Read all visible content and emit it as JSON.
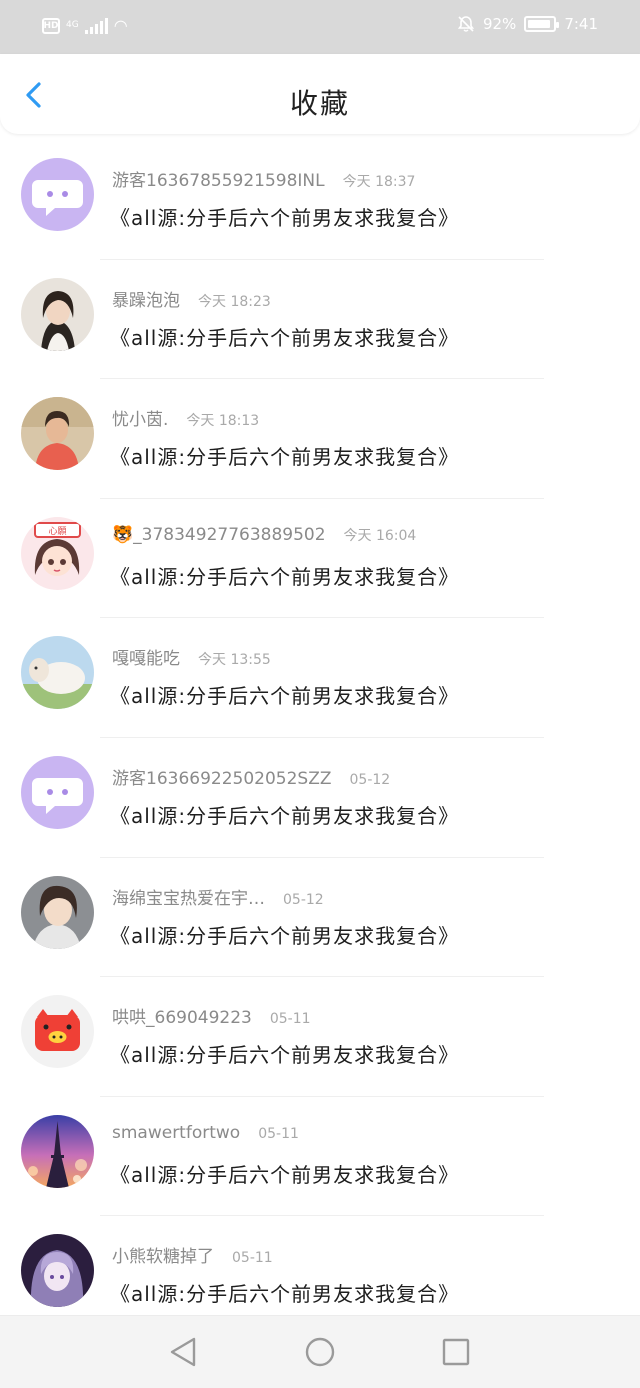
{
  "status_bar": {
    "hd": "HD",
    "network": "4G",
    "battery": "92%",
    "battery_level": 0.92,
    "time": "7:41",
    "icons": [
      "hd-icon",
      "signal-icon",
      "wifi-icon",
      "mute-icon",
      "battery-icon"
    ]
  },
  "header": {
    "title": "收藏",
    "back_icon": "chevron-left-icon",
    "accent": "#2f9bf3"
  },
  "items": [
    {
      "username": "游客16367855921598INL",
      "time": "今天 18:37",
      "message": "《all源:分手后六个前男友求我复合》",
      "avatar": "default-purple-chat"
    },
    {
      "username": "暴躁泡泡",
      "time": "今天 18:23",
      "message": "《all源:分手后六个前男友求我复合》",
      "avatar": "girl-portrait"
    },
    {
      "username": "忧小茵.",
      "time": "今天 18:13",
      "message": "《all源:分手后六个前男友求我复合》",
      "avatar": "girl-red-top"
    },
    {
      "username": "🐯_3783492776388950​2",
      "time": "今天 16:04",
      "message": "《all源:分手后六个前男友求我复合》",
      "avatar": "anime-girl"
    },
    {
      "username": "嘎嘎能吃",
      "time": "今天 13:55",
      "message": "《all源:分手后六个前男友求我复合》",
      "avatar": "sheep"
    },
    {
      "username": "游客16366922502052SZZ",
      "time": "05-12",
      "message": "《all源:分手后六个前男友求我复合》",
      "avatar": "default-purple-chat"
    },
    {
      "username": "海绵宝宝热爱在宇…",
      "time": "05-12",
      "message": "《all源:分手后六个前男友求我复合》",
      "avatar": "anime-boy"
    },
    {
      "username": "哄哄_669049223",
      "time": "05-11",
      "message": "《all源:分手后六个前男友求我复合》",
      "avatar": "red-pig"
    },
    {
      "username": "smawertfortwo",
      "time": "05-11",
      "message": "《all源:分手后六个前男友求我复合》",
      "avatar": "eiffel-tower"
    },
    {
      "username": "小熊软糖掉了",
      "time": "05-11",
      "message": "《all源:分手后六个前男友求我复合》",
      "avatar": "purple-anime"
    }
  ],
  "nav": {
    "icons": [
      "back-triangle-icon",
      "home-circle-icon",
      "recents-square-icon"
    ]
  }
}
